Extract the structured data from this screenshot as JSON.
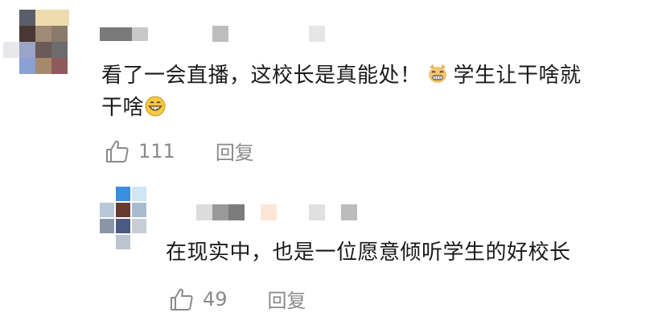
{
  "comment": {
    "text_line1": "看了一会直播，这校长是真能处！",
    "text_line1_after_emoji": "学生让干啥就",
    "text_line2": "干啥",
    "likes": "111",
    "reply_label": "回复",
    "emoji_1": "cat-grin-emoji",
    "emoji_2": "grinning-face-emoji"
  },
  "reply": {
    "text": "在现实中，也是一位愿意倾听学生的好校长",
    "likes": "49",
    "reply_label": "回复"
  },
  "colors": {
    "text": "#1a1a1a",
    "muted": "#8a8a8a"
  }
}
